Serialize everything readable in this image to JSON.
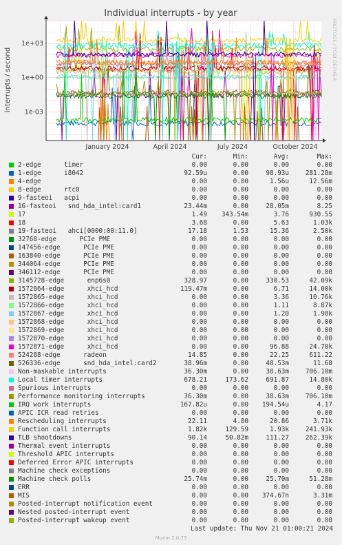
{
  "chart_data": {
    "type": "line",
    "title": "Individual interrupts - by year",
    "ylabel": "interrupts / second",
    "y_scale": "log",
    "ylim": [
      3e-06,
      100000
    ],
    "yticks": [
      {
        "value": 1000,
        "label": "1e+03"
      },
      {
        "value": 1,
        "label": "1e+00"
      },
      {
        "value": 0.001,
        "label": "1e-03"
      }
    ],
    "xticks": [
      "January 2024",
      "April 2024",
      "July 2024",
      "October 2024"
    ],
    "watermark": "RRDTOOL / TOBI OETIKER",
    "grid": true
  },
  "legend": {
    "headers": {
      "cur": "Cur:",
      "min": "Min:",
      "avg": "Avg:",
      "max": "Max:"
    },
    "rows": [
      {
        "label": "2-edge      timer",
        "color": "#00cc00",
        "cur": "0.00",
        "min": "0.00",
        "avg": "0.00",
        "max": "0.00"
      },
      {
        "label": "1-edge      i8042",
        "color": "#0066b3",
        "cur": "92.59u",
        "min": "0.00",
        "avg": "98.93u",
        "max": "281.28m"
      },
      {
        "label": "4-edge",
        "color": "#ff8000",
        "cur": "0.00",
        "min": "0.00",
        "avg": "1.56u",
        "max": "12.56m"
      },
      {
        "label": "8-edge      rtc0",
        "color": "#ffcc00",
        "cur": "0.00",
        "min": "0.00",
        "avg": "0.00",
        "max": "0.00"
      },
      {
        "label": "9-fasteoi   acpi",
        "color": "#330099",
        "cur": "0.00",
        "min": "0.00",
        "avg": "0.00",
        "max": "0.00"
      },
      {
        "label": "16-fasteoi   snd_hda_intel:card1",
        "color": "#990099",
        "cur": "23.44m",
        "min": "0.00",
        "avg": "28.05m",
        "max": "8.25"
      },
      {
        "label": "17",
        "color": "#ccff00",
        "cur": "1.49",
        "min": "343.54m",
        "avg": "3.76",
        "max": "930.55"
      },
      {
        "label": "18",
        "color": "#ff0000",
        "cur": "3.68",
        "min": "0.00",
        "avg": "5.63",
        "max": "1.03k"
      },
      {
        "label": "19-fasteoi   ahci[0000:00:11.0]",
        "color": "#808080",
        "cur": "17.18",
        "min": "1.53",
        "avg": "15.36",
        "max": "2.50k"
      },
      {
        "label": "32768-edge      PCIe PME",
        "color": "#008f00",
        "cur": "0.00",
        "min": "0.00",
        "avg": "0.00",
        "max": "0.00"
      },
      {
        "label": "147456-edge      PCIe PME",
        "color": "#00487d",
        "cur": "0.00",
        "min": "0.00",
        "avg": "0.00",
        "max": "0.00"
      },
      {
        "label": "163840-edge      PCIe PME",
        "color": "#b35a00",
        "cur": "0.00",
        "min": "0.00",
        "avg": "0.00",
        "max": "0.00"
      },
      {
        "label": "344064-edge      PCIe PME",
        "color": "#b38f00",
        "cur": "0.00",
        "min": "0.00",
        "avg": "0.00",
        "max": "0.00"
      },
      {
        "label": "346112-edge      PCIe PME",
        "color": "#6b006b",
        "cur": "0.00",
        "min": "0.00",
        "avg": "0.00",
        "max": "0.00"
      },
      {
        "label": "3145728-edge      enp6s0",
        "color": "#8fb300",
        "cur": "328.97",
        "min": "0.00",
        "avg": "330.53",
        "max": "42.09k"
      },
      {
        "label": "1572864-edge      xhci_hcd",
        "color": "#b30000",
        "cur": "119.47m",
        "min": "0.00",
        "avg": "6.71",
        "max": "14.00k"
      },
      {
        "label": "1572865-edge      xhci_hcd",
        "color": "#bebebe",
        "cur": "0.00",
        "min": "0.00",
        "avg": "3.36",
        "max": "10.76k"
      },
      {
        "label": "1572866-edge      xhci_hcd",
        "color": "#80ff80",
        "cur": "0.00",
        "min": "0.00",
        "avg": "1.11",
        "max": "8.87k"
      },
      {
        "label": "1572867-edge      xhci_hcd",
        "color": "#80c9ff",
        "cur": "0.00",
        "min": "0.00",
        "avg": "1.20",
        "max": "1.98k"
      },
      {
        "label": "1572868-edge      xhci_hcd",
        "color": "#ffc080",
        "cur": "0.00",
        "min": "0.00",
        "avg": "0.00",
        "max": "0.00"
      },
      {
        "label": "1572869-edge      xhci_hcd",
        "color": "#ffe680",
        "cur": "0.00",
        "min": "0.00",
        "avg": "0.00",
        "max": "0.00"
      },
      {
        "label": "1572870-edge      xhci_hcd",
        "color": "#aa80ff",
        "cur": "0.00",
        "min": "0.00",
        "avg": "0.00",
        "max": "0.00"
      },
      {
        "label": "1572871-edge      xhci_hcd",
        "color": "#ee00cc",
        "cur": "0.00",
        "min": "0.00",
        "avg": "96.88",
        "max": "24.70k"
      },
      {
        "label": "524288-edge      radeon",
        "color": "#ff8080",
        "cur": "14.85",
        "min": "0.00",
        "avg": "22.25",
        "max": "611.22"
      },
      {
        "label": "526336-edge      snd_hda_intel:card2",
        "color": "#666600",
        "cur": "38.96m",
        "min": "0.00",
        "avg": "48.53m",
        "max": "11.68"
      },
      {
        "label": "Non-maskable interrupts",
        "color": "#ffbfff",
        "cur": "36.30m",
        "min": "0.00",
        "avg": "38.63m",
        "max": "706.10m"
      },
      {
        "label": "Local timer interrupts",
        "color": "#00ffcc",
        "cur": "678.21",
        "min": "173.62",
        "avg": "691.87",
        "max": "14.80k"
      },
      {
        "label": "Spurious interrupts",
        "color": "#cc6699",
        "cur": "0.00",
        "min": "0.00",
        "avg": "0.00",
        "max": "0.00"
      },
      {
        "label": "Performance monitoring interrupts",
        "color": "#999900",
        "cur": "36.30m",
        "min": "0.00",
        "avg": "38.63m",
        "max": "706.10m"
      },
      {
        "label": "IRQ work interrupts",
        "color": "#00cc00",
        "cur": "167.82u",
        "min": "0.00",
        "avg": "194.54u",
        "max": "4.17"
      },
      {
        "label": "APIC ICR read retries",
        "color": "#0066b3",
        "cur": "0.00",
        "min": "0.00",
        "avg": "0.00",
        "max": "0.00"
      },
      {
        "label": "Rescheduling interrupts",
        "color": "#ff8000",
        "cur": "22.11",
        "min": "4.80",
        "avg": "20.86",
        "max": "3.71k"
      },
      {
        "label": "Function call interrupts",
        "color": "#ffcc00",
        "cur": "1.82k",
        "min": "129.59",
        "avg": "1.93k",
        "max": "241.93k"
      },
      {
        "label": "TLB shootdowns",
        "color": "#330099",
        "cur": "90.14",
        "min": "50.82m",
        "avg": "111.27",
        "max": "262.39k"
      },
      {
        "label": "Thermal event interrupts",
        "color": "#990099",
        "cur": "0.00",
        "min": "0.00",
        "avg": "0.00",
        "max": "0.00"
      },
      {
        "label": "Threshold APIC interrupts",
        "color": "#ccff00",
        "cur": "0.00",
        "min": "0.00",
        "avg": "0.00",
        "max": "0.00"
      },
      {
        "label": "Deferred Error APIC interrupts",
        "color": "#ff0000",
        "cur": "0.00",
        "min": "0.00",
        "avg": "0.00",
        "max": "0.00"
      },
      {
        "label": "Machine check exceptions",
        "color": "#808080",
        "cur": "0.00",
        "min": "0.00",
        "avg": "0.00",
        "max": "0.00"
      },
      {
        "label": "Machine check polls",
        "color": "#008f00",
        "cur": "25.74m",
        "min": "0.00",
        "avg": "25.70m",
        "max": "51.28m"
      },
      {
        "label": "ERR",
        "color": "#00487d",
        "cur": "0.00",
        "min": "0.00",
        "avg": "0.00",
        "max": "0.00"
      },
      {
        "label": "MIS",
        "color": "#b35a00",
        "cur": "0.00",
        "min": "0.00",
        "avg": "374.67n",
        "max": "3.31m"
      },
      {
        "label": "Posted-interrupt notification event",
        "color": "#b38f00",
        "cur": "0.00",
        "min": "0.00",
        "avg": "0.00",
        "max": "0.00"
      },
      {
        "label": "Nested posted-interrupt event",
        "color": "#6b006b",
        "cur": "0.00",
        "min": "0.00",
        "avg": "0.00",
        "max": "0.00"
      },
      {
        "label": "Posted-interrupt wakeup event",
        "color": "#8fb300",
        "cur": "0.00",
        "min": "0.00",
        "avg": "0.00",
        "max": "0.00"
      }
    ]
  },
  "footer": {
    "last_update": "Last update: Thu Nov 21 01:00:21 2024",
    "munin_version": "Munin 2.0.73"
  }
}
